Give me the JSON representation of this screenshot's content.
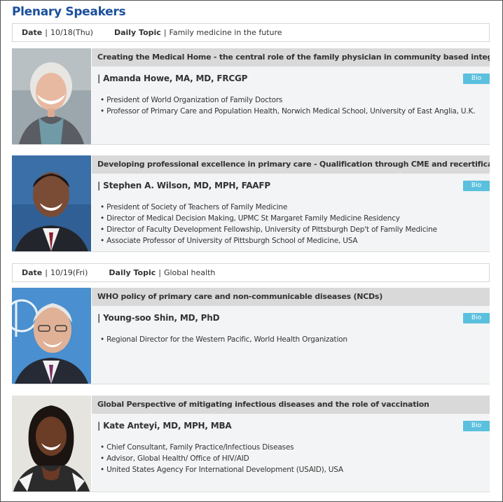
{
  "page_title": "Plenary Speakers",
  "days": [
    {
      "date_label": "Date",
      "date_value": "10/18(Thu)",
      "topic_label": "Daily Topic",
      "topic_value": "Family medicine in the future",
      "talks": [
        {
          "title": "Creating the Medical Home - the central role of the family physician in community based integrated care",
          "speaker": "| Amanda Howe, MA, MD, FRCGP",
          "bio_label": "Bio",
          "roles": [
            "President of World Organization of Family Doctors",
            "Professor of Primary Care and Population Health, Norwich Medical School, University of East Anglia, U.K."
          ]
        },
        {
          "title": "Developing professional excellence in primary care - Qualification through CME and recertification system",
          "speaker": "| Stephen A. Wilson, MD, MPH, FAAFP",
          "bio_label": "Bio",
          "roles": [
            "President of Society of Teachers of Family Medicine",
            "Director of Medical Decision Making, UPMC St Margaret Family Medicine Residency",
            "Director of Faculty Development Fellowship, University of Pittsburgh Dep't of Family Medicine",
            "Associate Professor of University of Pittsburgh School of Medicine, USA"
          ]
        }
      ]
    },
    {
      "date_label": "Date",
      "date_value": "10/19(Fri)",
      "topic_label": "Daily Topic",
      "topic_value": "Global health",
      "talks": [
        {
          "title": "WHO policy of primary care and non-communicable diseases (NCDs)",
          "speaker": "| Young-soo Shin, MD, PhD",
          "bio_label": "Bio",
          "roles": [
            "Regional Director for the Western Pacific, World Health Organization"
          ]
        },
        {
          "title": "Global Perspective of mitigating infectious diseases and the role of vaccination",
          "speaker": "| Kate Anteyi, MD, MPH, MBA",
          "bio_label": "Bio",
          "roles": [
            "Chief Consultant, Family Practice/Infectious Diseases",
            "Advisor, Global Health/ Office of HIV/AID",
            "United States Agency For International Development (USAID), USA"
          ]
        }
      ]
    }
  ],
  "colors": {
    "title_blue": "#1b4f9c",
    "bio_button": "#5bc0de",
    "talk_title_bg": "#d9d9d9",
    "card_bg": "#f3f4f5"
  }
}
